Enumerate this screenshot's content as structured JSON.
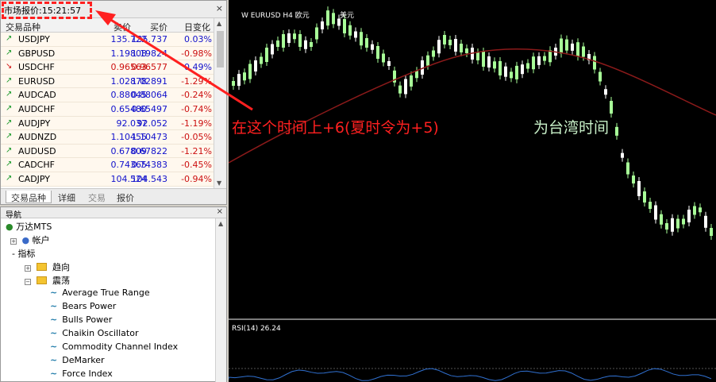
{
  "market_watch": {
    "title": "市场报价:15:21:57",
    "close": "×",
    "headers": {
      "symbol": "交易品种",
      "bid": "卖价",
      "ask": "买价",
      "change": "日变化"
    },
    "rows": [
      {
        "symbol": "USDJPY",
        "bid": "135.722",
        "ask": "135.737",
        "change": "0.03%",
        "dir": "up"
      },
      {
        "symbol": "GBPUSD",
        "bid": "1.19808",
        "ask": "1.19824",
        "change": "-0.98%",
        "dir": "up"
      },
      {
        "symbol": "USDCHF",
        "bid": "0.96563",
        "ask": "0.96577",
        "change": "0.49%",
        "dir": "down"
      },
      {
        "symbol": "EURUSD",
        "bid": "1.02878",
        "ask": "1.02891",
        "change": "-1.29%",
        "dir": "up"
      },
      {
        "symbol": "AUDCAD",
        "bid": "0.88045",
        "ask": "0.88064",
        "change": "-0.24%",
        "dir": "up"
      },
      {
        "symbol": "AUDCHF",
        "bid": "0.65480",
        "ask": "0.65497",
        "change": "-0.74%",
        "dir": "up"
      },
      {
        "symbol": "AUDJPY",
        "bid": "92.037",
        "ask": "92.052",
        "change": "-1.19%",
        "dir": "up"
      },
      {
        "symbol": "AUDNZD",
        "bid": "1.10455",
        "ask": "1.10473",
        "change": "-0.05%",
        "dir": "up"
      },
      {
        "symbol": "AUDUSD",
        "bid": "0.67809",
        "ask": "0.67822",
        "change": "-1.21%",
        "dir": "up"
      },
      {
        "symbol": "CADCHF",
        "bid": "0.74365",
        "ask": "0.74383",
        "change": "-0.45%",
        "dir": "up"
      },
      {
        "symbol": "CADJPY",
        "bid": "104.524",
        "ask": "104.543",
        "change": "-0.94%",
        "dir": "up"
      }
    ],
    "tabs": [
      "交易品种",
      "详细",
      "交易",
      "报价"
    ]
  },
  "navigator": {
    "title": "导航",
    "close": "×",
    "broker": "万达MTS",
    "accounts": "帐户",
    "indicators": "指标",
    "folder_trend": "趋向",
    "folder_oscillators": "震荡",
    "items": [
      "Average True Range",
      "Bears Power",
      "Bulls Power",
      "Chaikin Oscillator",
      "Commodity Channel Index",
      "DeMarker",
      "Force Index"
    ]
  },
  "chart": {
    "title": "W EURUSD H4 欧元",
    "currency": "美元",
    "rsi_label": "RSI(14) 26.24",
    "annotation_red": "在这个时间上+6(夏时令为+5)",
    "annotation_green": "为台湾时间",
    "colors": {
      "up": "#a8ff98",
      "down": "#ffffff",
      "ma": "#8b1a1a",
      "annotation": "#ff2020"
    }
  }
}
